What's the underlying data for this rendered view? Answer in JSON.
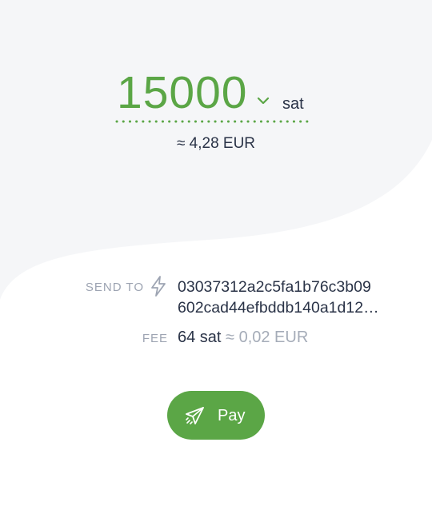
{
  "amount": {
    "value": "15000",
    "unit": "sat",
    "fiat": "≈ 4,28 EUR"
  },
  "send_to": {
    "label": "SEND TO",
    "address_line1": "03037312a2c5fa1b76c3b09",
    "address_line2": "602cad44efbddb140a1d12…"
  },
  "fee": {
    "label": "FEE",
    "amount": "64 sat",
    "approx": " ≈ 0,02 EUR"
  },
  "pay_button": {
    "label": "Pay"
  },
  "colors": {
    "accent": "#5ba646",
    "text": "#2a3347",
    "muted": "#9da4b2",
    "background_shape": "#f5f6f8"
  },
  "icons": {
    "unit_selector": "chevron-down-icon",
    "send_to": "lightning-bolt-icon",
    "pay": "paper-plane-icon"
  }
}
